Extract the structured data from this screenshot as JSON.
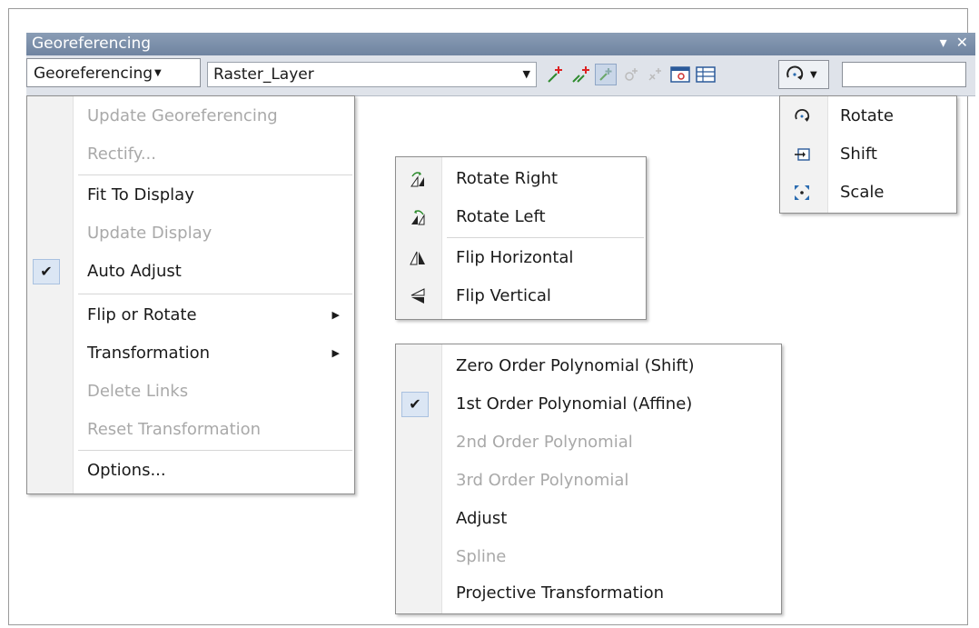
{
  "window": {
    "title": "Georeferencing",
    "controls": "▾ ✕"
  },
  "toolbar": {
    "menu_label": "Georeferencing",
    "layer_value": "Raster_Layer",
    "input_value": ""
  },
  "main_menu": {
    "items": [
      {
        "label": "Update Georeferencing",
        "enabled": false
      },
      {
        "label": "Rectify...",
        "enabled": false
      },
      {
        "label": "Fit To Display",
        "enabled": true
      },
      {
        "label": "Update Display",
        "enabled": false
      },
      {
        "label": "Auto Adjust",
        "enabled": true,
        "checked": true
      },
      {
        "label": "Flip or Rotate",
        "enabled": true,
        "submenu": true
      },
      {
        "label": "Transformation",
        "enabled": true,
        "submenu": true
      },
      {
        "label": "Delete Links",
        "enabled": false
      },
      {
        "label": "Reset Transformation",
        "enabled": false
      },
      {
        "label": "Options...",
        "enabled": true
      }
    ]
  },
  "flip_menu": {
    "items": [
      {
        "label": "Rotate Right",
        "icon": "rotate-right-icon"
      },
      {
        "label": "Rotate Left",
        "icon": "rotate-left-icon"
      },
      {
        "label": "Flip Horizontal",
        "icon": "flip-horizontal-icon"
      },
      {
        "label": "Flip Vertical",
        "icon": "flip-vertical-icon"
      }
    ]
  },
  "transform_menu": {
    "items": [
      {
        "label": "Zero Order Polynomial (Shift)",
        "enabled": true
      },
      {
        "label": "1st Order Polynomial (Affine)",
        "enabled": true,
        "checked": true
      },
      {
        "label": "2nd Order Polynomial",
        "enabled": false
      },
      {
        "label": "3rd Order Polynomial",
        "enabled": false
      },
      {
        "label": "Adjust",
        "enabled": true
      },
      {
        "label": "Spline",
        "enabled": false
      },
      {
        "label": "Projective Transformation",
        "enabled": true
      }
    ]
  },
  "rotate_menu": {
    "items": [
      {
        "label": "Rotate",
        "icon": "rotate-icon"
      },
      {
        "label": "Shift",
        "icon": "shift-icon"
      },
      {
        "label": "Scale",
        "icon": "scale-icon"
      }
    ]
  },
  "colors": {
    "titlebar": "#7a8ea9",
    "menu_gutter": "#f2f2f2",
    "check_bg": "#dbe6f4",
    "disabled_text": "#a9a9a9"
  }
}
